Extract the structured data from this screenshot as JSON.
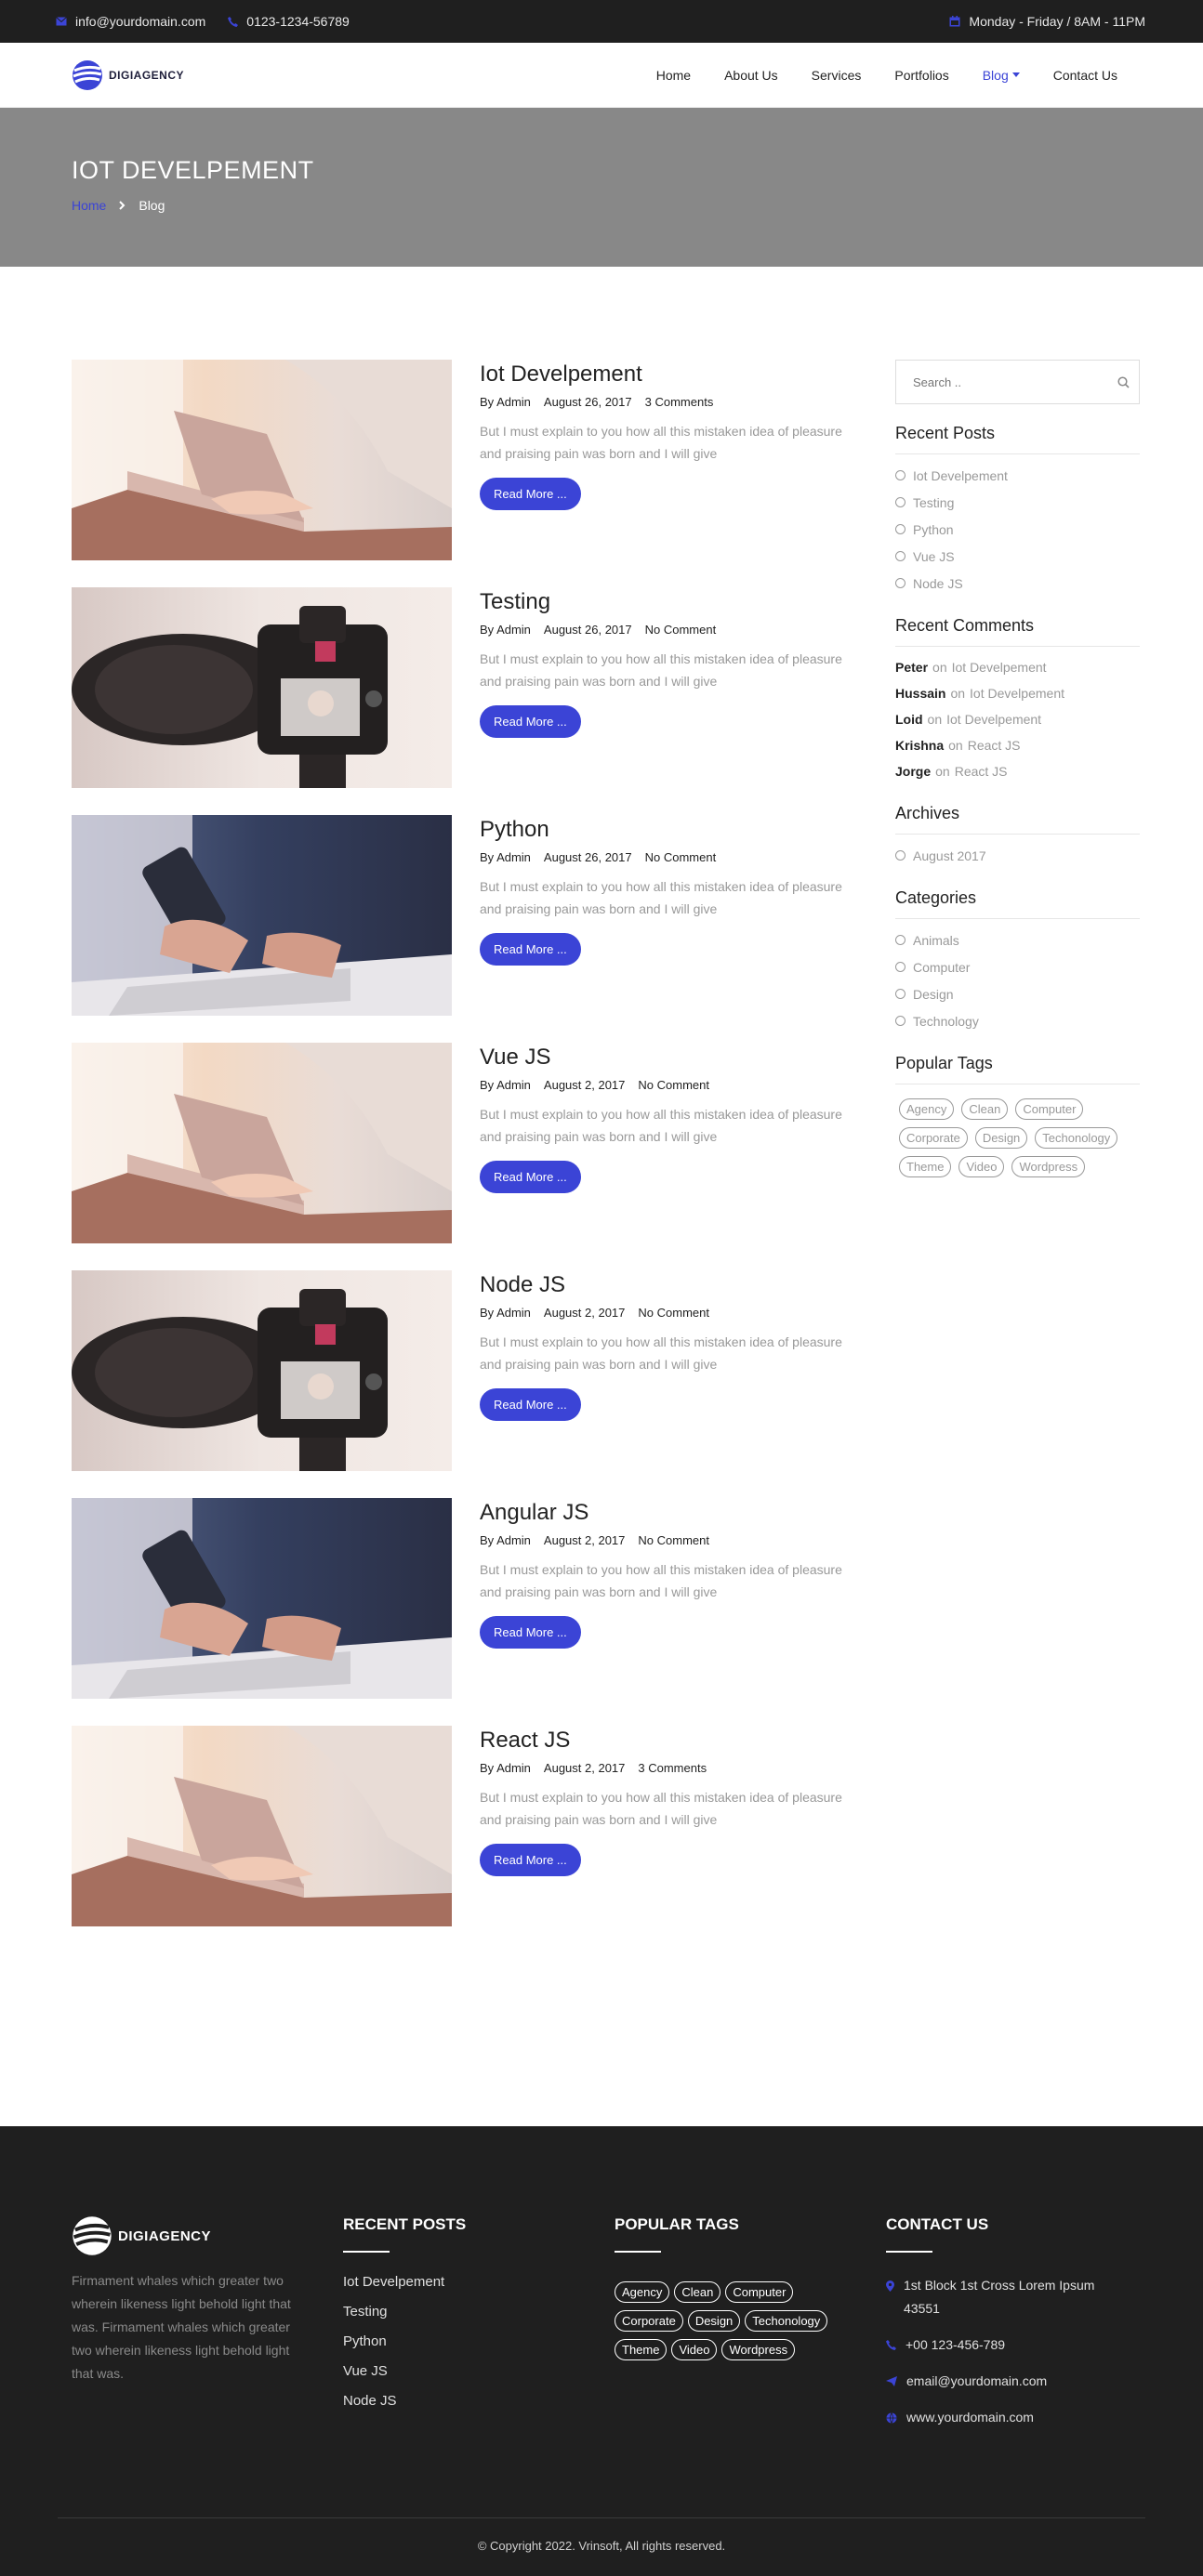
{
  "topbar": {
    "email": "info@yourdomain.com",
    "phone": "0123-1234-56789",
    "hours": "Monday - Friday / 8AM - 11PM"
  },
  "header": {
    "logo_text": "DIGIAGENCY",
    "nav": [
      {
        "label": "Home"
      },
      {
        "label": "About Us"
      },
      {
        "label": "Services"
      },
      {
        "label": "Portfolios"
      },
      {
        "label": "Blog"
      },
      {
        "label": "Contact Us"
      }
    ]
  },
  "banner": {
    "title": "IOT DEVELPEMENT",
    "crumb_home": "Home",
    "crumb_current": "Blog"
  },
  "posts": [
    {
      "title": "Iot Develpement",
      "author": "By Admin",
      "date": "August 26, 2017",
      "comments": "3 Comments",
      "excerpt": "But I must explain to you how all this mistaken idea of pleasure and praising pain was born and I will give",
      "read_more": "Read More ...",
      "image": "laptop-photo"
    },
    {
      "title": "Testing",
      "author": "By Admin",
      "date": "August 26, 2017",
      "comments": "No Comment",
      "excerpt": "But I must explain to you how all this mistaken idea of pleasure and praising pain was born and I will give",
      "read_more": "Read More ...",
      "image": "camera-photo"
    },
    {
      "title": "Python",
      "author": "By Admin",
      "date": "August 26, 2017",
      "comments": "No Comment",
      "excerpt": "But I must explain to you how all this mistaken idea of pleasure and praising pain was born and I will give",
      "read_more": "Read More ...",
      "image": "phone-photo"
    },
    {
      "title": "Vue JS",
      "author": "By Admin",
      "date": "August 2, 2017",
      "comments": "No Comment",
      "excerpt": "But I must explain to you how all this mistaken idea of pleasure and praising pain was born and I will give",
      "read_more": "Read More ...",
      "image": "laptop-photo"
    },
    {
      "title": "Node JS",
      "author": "By Admin",
      "date": "August 2, 2017",
      "comments": "No Comment",
      "excerpt": "But I must explain to you how all this mistaken idea of pleasure and praising pain was born and I will give",
      "read_more": "Read More ...",
      "image": "camera-photo"
    },
    {
      "title": "Angular JS",
      "author": "By Admin",
      "date": "August 2, 2017",
      "comments": "No Comment",
      "excerpt": "But I must explain to you how all this mistaken idea of pleasure and praising pain was born and I will give",
      "read_more": "Read More ...",
      "image": "phone-photo"
    },
    {
      "title": "React JS",
      "author": "By Admin",
      "date": "August 2, 2017",
      "comments": "3 Comments",
      "excerpt": "But I must explain to you how all this mistaken idea of pleasure and praising pain was born and I will give",
      "read_more": "Read More ...",
      "image": "laptop-photo"
    }
  ],
  "sidebar": {
    "search_placeholder": "Search ..",
    "recent_posts_title": "Recent Posts",
    "recent_posts": [
      "Iot Develpement",
      "Testing",
      "Python",
      "Vue JS",
      "Node JS"
    ],
    "recent_comments_title": "Recent Comments",
    "recent_comments": [
      {
        "name": "Peter",
        "on": "on",
        "post": "Iot Develpement"
      },
      {
        "name": "Hussain",
        "on": "on",
        "post": "Iot Develpement"
      },
      {
        "name": "Loid",
        "on": "on",
        "post": "Iot Develpement"
      },
      {
        "name": "Krishna",
        "on": "on",
        "post": "React JS"
      },
      {
        "name": "Jorge",
        "on": "on",
        "post": "React JS"
      }
    ],
    "archives_title": "Archives",
    "archives": [
      "August 2017"
    ],
    "categories_title": "Categories",
    "categories": [
      "Animals",
      "Computer",
      "Design",
      "Technology"
    ],
    "tags_title": "Popular Tags",
    "tags": [
      "Agency",
      "Clean",
      "Computer",
      "Corporate",
      "Design",
      "Techonology",
      "Theme",
      "Video",
      "Wordpress"
    ]
  },
  "footer": {
    "logo_text": "DIGIAGENCY",
    "description": "Firmament whales which greater two wherein likeness light behold light that was. Firmament whales which greater two wherein likeness light behold light that was.",
    "recent_title": "RECENT POSTS",
    "recent": [
      "Iot Develpement",
      "Testing",
      "Python",
      "Vue JS",
      "Node JS"
    ],
    "tags_title": "POPULAR TAGS",
    "tags": [
      "Agency",
      "Clean",
      "Computer",
      "Corporate",
      "Design",
      "Techonology",
      "Theme",
      "Video",
      "Wordpress"
    ],
    "contact_title": "CONTACT US",
    "address": "1st Block 1st Cross Lorem Ipsum 43551",
    "phone": "+00 123-456-789",
    "email": "email@yourdomain.com",
    "website": "www.yourdomain.com",
    "copyright": "© Copyright 2022. Vrinsoft, All rights reserved."
  },
  "colors": {
    "accent": "#3b44d6",
    "dark": "#1f1f1f",
    "banner": "#888888"
  },
  "icons": {
    "email": "envelope-icon",
    "phone": "phone-icon",
    "hours": "calendar-icon",
    "search": "search-icon",
    "location": "map-pin-icon",
    "send": "paper-plane-icon",
    "web": "globe-icon"
  }
}
